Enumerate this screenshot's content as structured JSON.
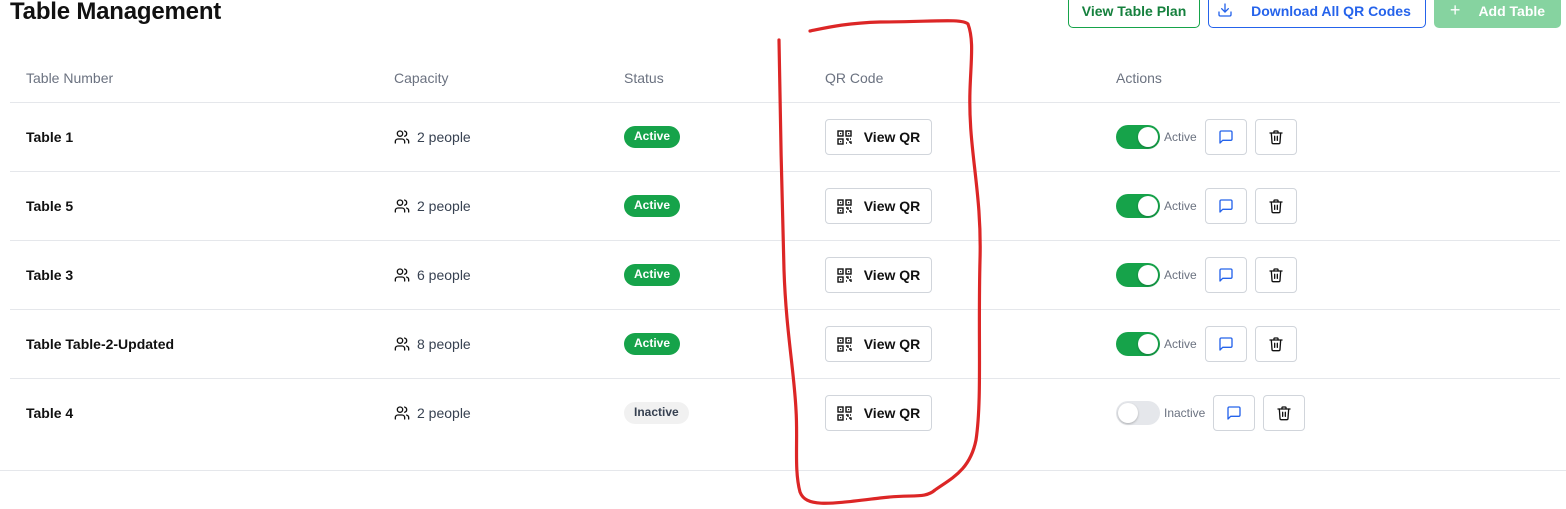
{
  "header": {
    "title": "Table Management",
    "view_table_plan_label": "View Table Plan",
    "download_qr_label": "Download All QR Codes",
    "add_table_label": "Add Table"
  },
  "table": {
    "columns": [
      "Table Number",
      "Capacity",
      "Status",
      "QR Code",
      "Actions"
    ],
    "rows": [
      {
        "name": "Table 1",
        "capacity": "2 people",
        "status": "Active",
        "qr_label": "View QR",
        "toggle_on": true,
        "toggle_label": "Active"
      },
      {
        "name": "Table 5",
        "capacity": "2 people",
        "status": "Active",
        "qr_label": "View QR",
        "toggle_on": true,
        "toggle_label": "Active"
      },
      {
        "name": "Table 3",
        "capacity": "6 people",
        "status": "Active",
        "qr_label": "View QR",
        "toggle_on": true,
        "toggle_label": "Active"
      },
      {
        "name": "Table Table-2-Updated",
        "capacity": "8 people",
        "status": "Active",
        "qr_label": "View QR",
        "toggle_on": true,
        "toggle_label": "Active"
      },
      {
        "name": "Table 4",
        "capacity": "2 people",
        "status": "Inactive",
        "qr_label": "View QR",
        "toggle_on": false,
        "toggle_label": "Inactive"
      }
    ]
  },
  "icons": {
    "download": "download-icon",
    "add": "plus-icon",
    "capacity": "users-icon",
    "qr": "qr-code-icon",
    "message": "message-square-icon",
    "delete": "trash-icon"
  },
  "colors": {
    "primary_green": "#16a34a",
    "primary_blue": "#2563eb",
    "add_button_disabled": "#86d3a0",
    "annotation_red": "#dc2626"
  }
}
